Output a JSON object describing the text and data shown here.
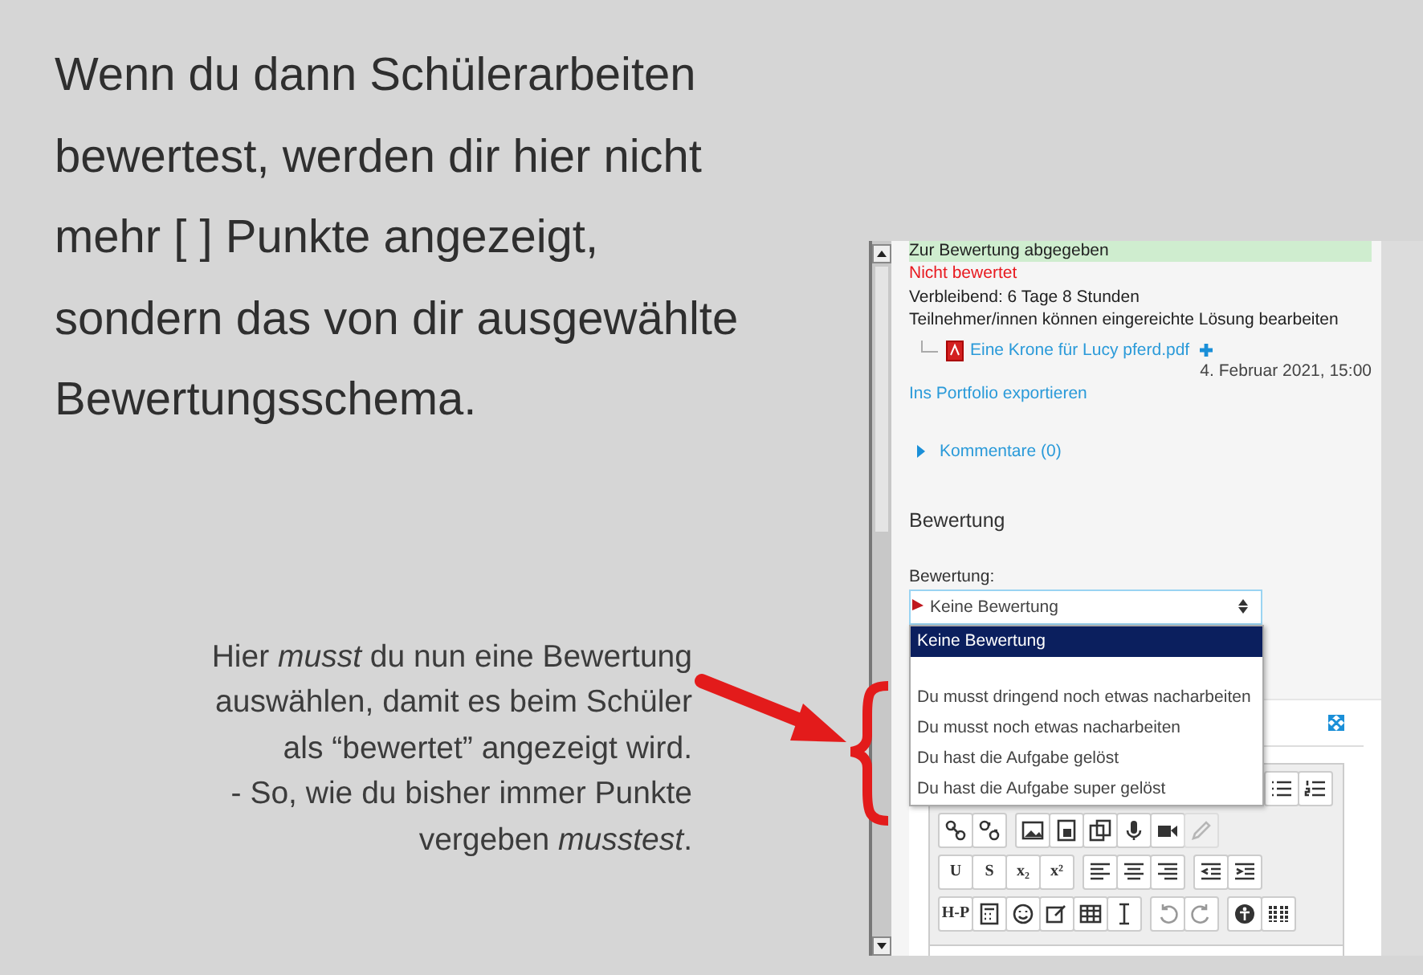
{
  "heading": "Wenn du dann Schülerarbeiten\nbewertest, werden dir hier nicht\nmehr [   ] Punkte angezeigt,\nsondern das von dir ausgewählte\nBewertungsschema.",
  "note": "Hier *musst* du nun eine Bewertung\nauswählen, damit es beim Schüler\nals “bewertet” angezeigt wird.\n- So, wie du bisher immer Punkte\nvergeben *musstest*.",
  "screenshot": {
    "submission_status": "Zur Bewertung abgegeben",
    "grading_status": "Nicht bewertet",
    "remaining": "Verbleibend: 6 Tage 8 Stunden",
    "edit_note": "Teilnehmer/innen können eingereichte Lösung bearbeiten",
    "file": {
      "name": "Eine Krone für Lucy pferd.pdf",
      "date": "4. Februar 2021, 15:00"
    },
    "export_link": "Ins Portfolio exportieren",
    "comments": {
      "label": "Kommentare (0)",
      "expanded": false
    },
    "grading": {
      "section_title": "Bewertung",
      "field_label": "Bewertung:",
      "select": {
        "value": "Keine Bewertung",
        "open": true,
        "options": [
          {
            "label": "Keine Bewertung",
            "selected": true
          },
          {
            "label": "Du musst dringend noch etwas nacharbeiten",
            "selected": false
          },
          {
            "label": "Du musst noch etwas nacharbeiten",
            "selected": false
          },
          {
            "label": "Du hast die Aufgabe gelöst",
            "selected": false
          },
          {
            "label": "Du hast die Aufgabe super gelöst",
            "selected": false
          }
        ]
      }
    },
    "editor_toolbar": [
      [
        [
          {
            "kind": "bullets",
            "disabled": false
          },
          {
            "kind": "numbers",
            "disabled": false
          }
        ]
      ],
      [
        [
          {
            "kind": "link",
            "disabled": false
          },
          {
            "kind": "unlink",
            "disabled": false
          }
        ],
        [
          {
            "kind": "image",
            "disabled": false
          },
          {
            "kind": "media",
            "disabled": false
          },
          {
            "kind": "copy",
            "disabled": false
          },
          {
            "kind": "mic",
            "disabled": false
          },
          {
            "kind": "video",
            "disabled": false
          },
          {
            "kind": "pencil",
            "disabled": true
          }
        ]
      ],
      [
        [
          {
            "kind": "text",
            "label": "U",
            "disabled": false
          },
          {
            "kind": "text",
            "label": "S",
            "disabled": false
          },
          {
            "kind": "text",
            "label": "x₂",
            "disabled": false
          },
          {
            "kind": "text",
            "label": "x²",
            "disabled": false
          }
        ],
        [
          {
            "kind": "align-left",
            "disabled": false
          },
          {
            "kind": "align-center",
            "disabled": false
          },
          {
            "kind": "align-right",
            "disabled": false
          }
        ],
        [
          {
            "kind": "outdent",
            "disabled": false
          },
          {
            "kind": "indent",
            "disabled": false
          }
        ]
      ],
      [
        [
          {
            "kind": "text",
            "label": "H-P",
            "disabled": false
          },
          {
            "kind": "calculator",
            "disabled": false
          },
          {
            "kind": "smiley",
            "disabled": false
          },
          {
            "kind": "edit",
            "disabled": false
          },
          {
            "kind": "table",
            "disabled": false
          },
          {
            "kind": "cursor",
            "disabled": false
          }
        ],
        [
          {
            "kind": "undo",
            "disabled": false
          },
          {
            "kind": "redo",
            "disabled": false
          }
        ],
        [
          {
            "kind": "accessibility",
            "disabled": false
          },
          {
            "kind": "grid",
            "disabled": false
          }
        ]
      ]
    ]
  }
}
